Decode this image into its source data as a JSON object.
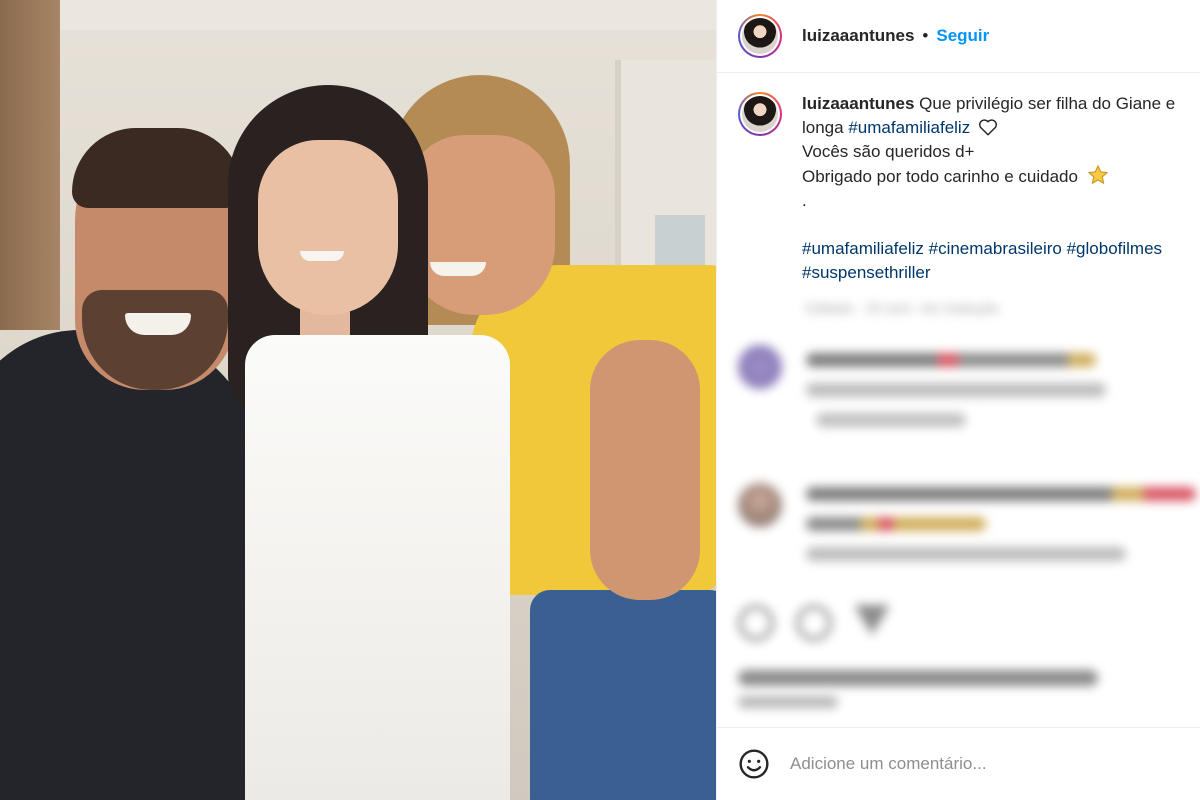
{
  "post": {
    "username": "luizaaantunes",
    "separator": "•",
    "follow_label": "Seguir"
  },
  "caption": {
    "username": "luizaaantunes",
    "line1": "Que privilégio ser filha do Giane e",
    "line2_prefix": "longa ",
    "line2_tag": "#umafamiliafeliz",
    "line3": "Vocês são queridos d+",
    "line4": "Obrigado por todo carinho e cuidado",
    "line5": ".",
    "hashtags_line1": [
      "#umafamiliafeliz",
      "#cinemabrasileiro",
      "#globofilmes"
    ],
    "hashtags_line2": [
      "#suspensethriller"
    ],
    "meta": "Editado · 20 sem.   Ver tradução"
  },
  "comment_box": {
    "placeholder": "Adicione um comentário..."
  },
  "icons": {
    "heart": "heart-outline-icon",
    "star": "star-emoji-icon",
    "emoji": "smiley-icon"
  },
  "colors": {
    "follow": "#0095f6",
    "hashtag": "#00376b",
    "story_ring": [
      "#f58529",
      "#dd2a7b",
      "#8134af",
      "#515bd4"
    ]
  }
}
